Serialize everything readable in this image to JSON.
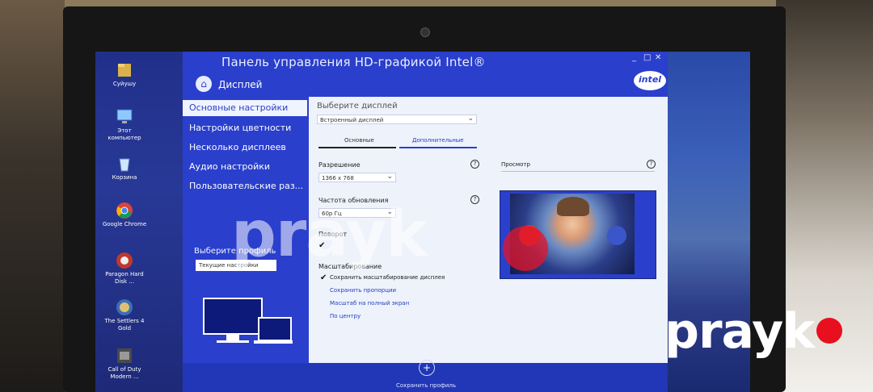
{
  "window": {
    "title": "Панель управления HD-графикой Intel®",
    "section": "Дисплей",
    "brand": "intel"
  },
  "desktop": {
    "icons": [
      {
        "label": "Суйушу",
        "icon": "user-folder-icon"
      },
      {
        "label": "Этот компьютер",
        "icon": "computer-icon"
      },
      {
        "label": "Корзина",
        "icon": "recycle-bin-icon"
      },
      {
        "label": "Google Chrome",
        "icon": "chrome-icon"
      },
      {
        "label": "Paragon Hard Disk ...",
        "icon": "paragon-icon"
      },
      {
        "label": "The Settlers 4 Gold",
        "icon": "settlers-icon"
      },
      {
        "label": "Call of Duty Modern ...",
        "icon": "cod-icon"
      }
    ]
  },
  "nav": {
    "items": [
      {
        "label": "Основные настройки",
        "active": true
      },
      {
        "label": "Настройки цветности",
        "active": false
      },
      {
        "label": "Несколько дисплеев",
        "active": false
      },
      {
        "label": "Аудио настройки",
        "active": false
      },
      {
        "label": "Пользовательские раз...",
        "active": false
      }
    ],
    "profile_label": "Выберите профиль",
    "profile_value": "Текущие настройки"
  },
  "content": {
    "select_display_label": "Выберите дисплей",
    "select_display_value": "Встроенный дисплей",
    "tabs": [
      "Основные",
      "Дополнительные"
    ],
    "resolution_label": "Разрешение",
    "resolution_value": "1366 x 768",
    "refresh_label": "Частота обновления",
    "refresh_value": "60p Гц",
    "rotation_label": "Поворот",
    "scaling_label": "Масштабирование",
    "scaling_checkbox": "Сохранить масштабирование дисплея",
    "scaling_options": [
      "Сохранить пропорции",
      "Масштаб на полный экран",
      "По центру"
    ],
    "preview_label": "Просмотр"
  },
  "footer": {
    "save_label": "Сохранить профиль"
  },
  "watermark": {
    "text": "prayk",
    "dot_color": "#e8101e"
  }
}
